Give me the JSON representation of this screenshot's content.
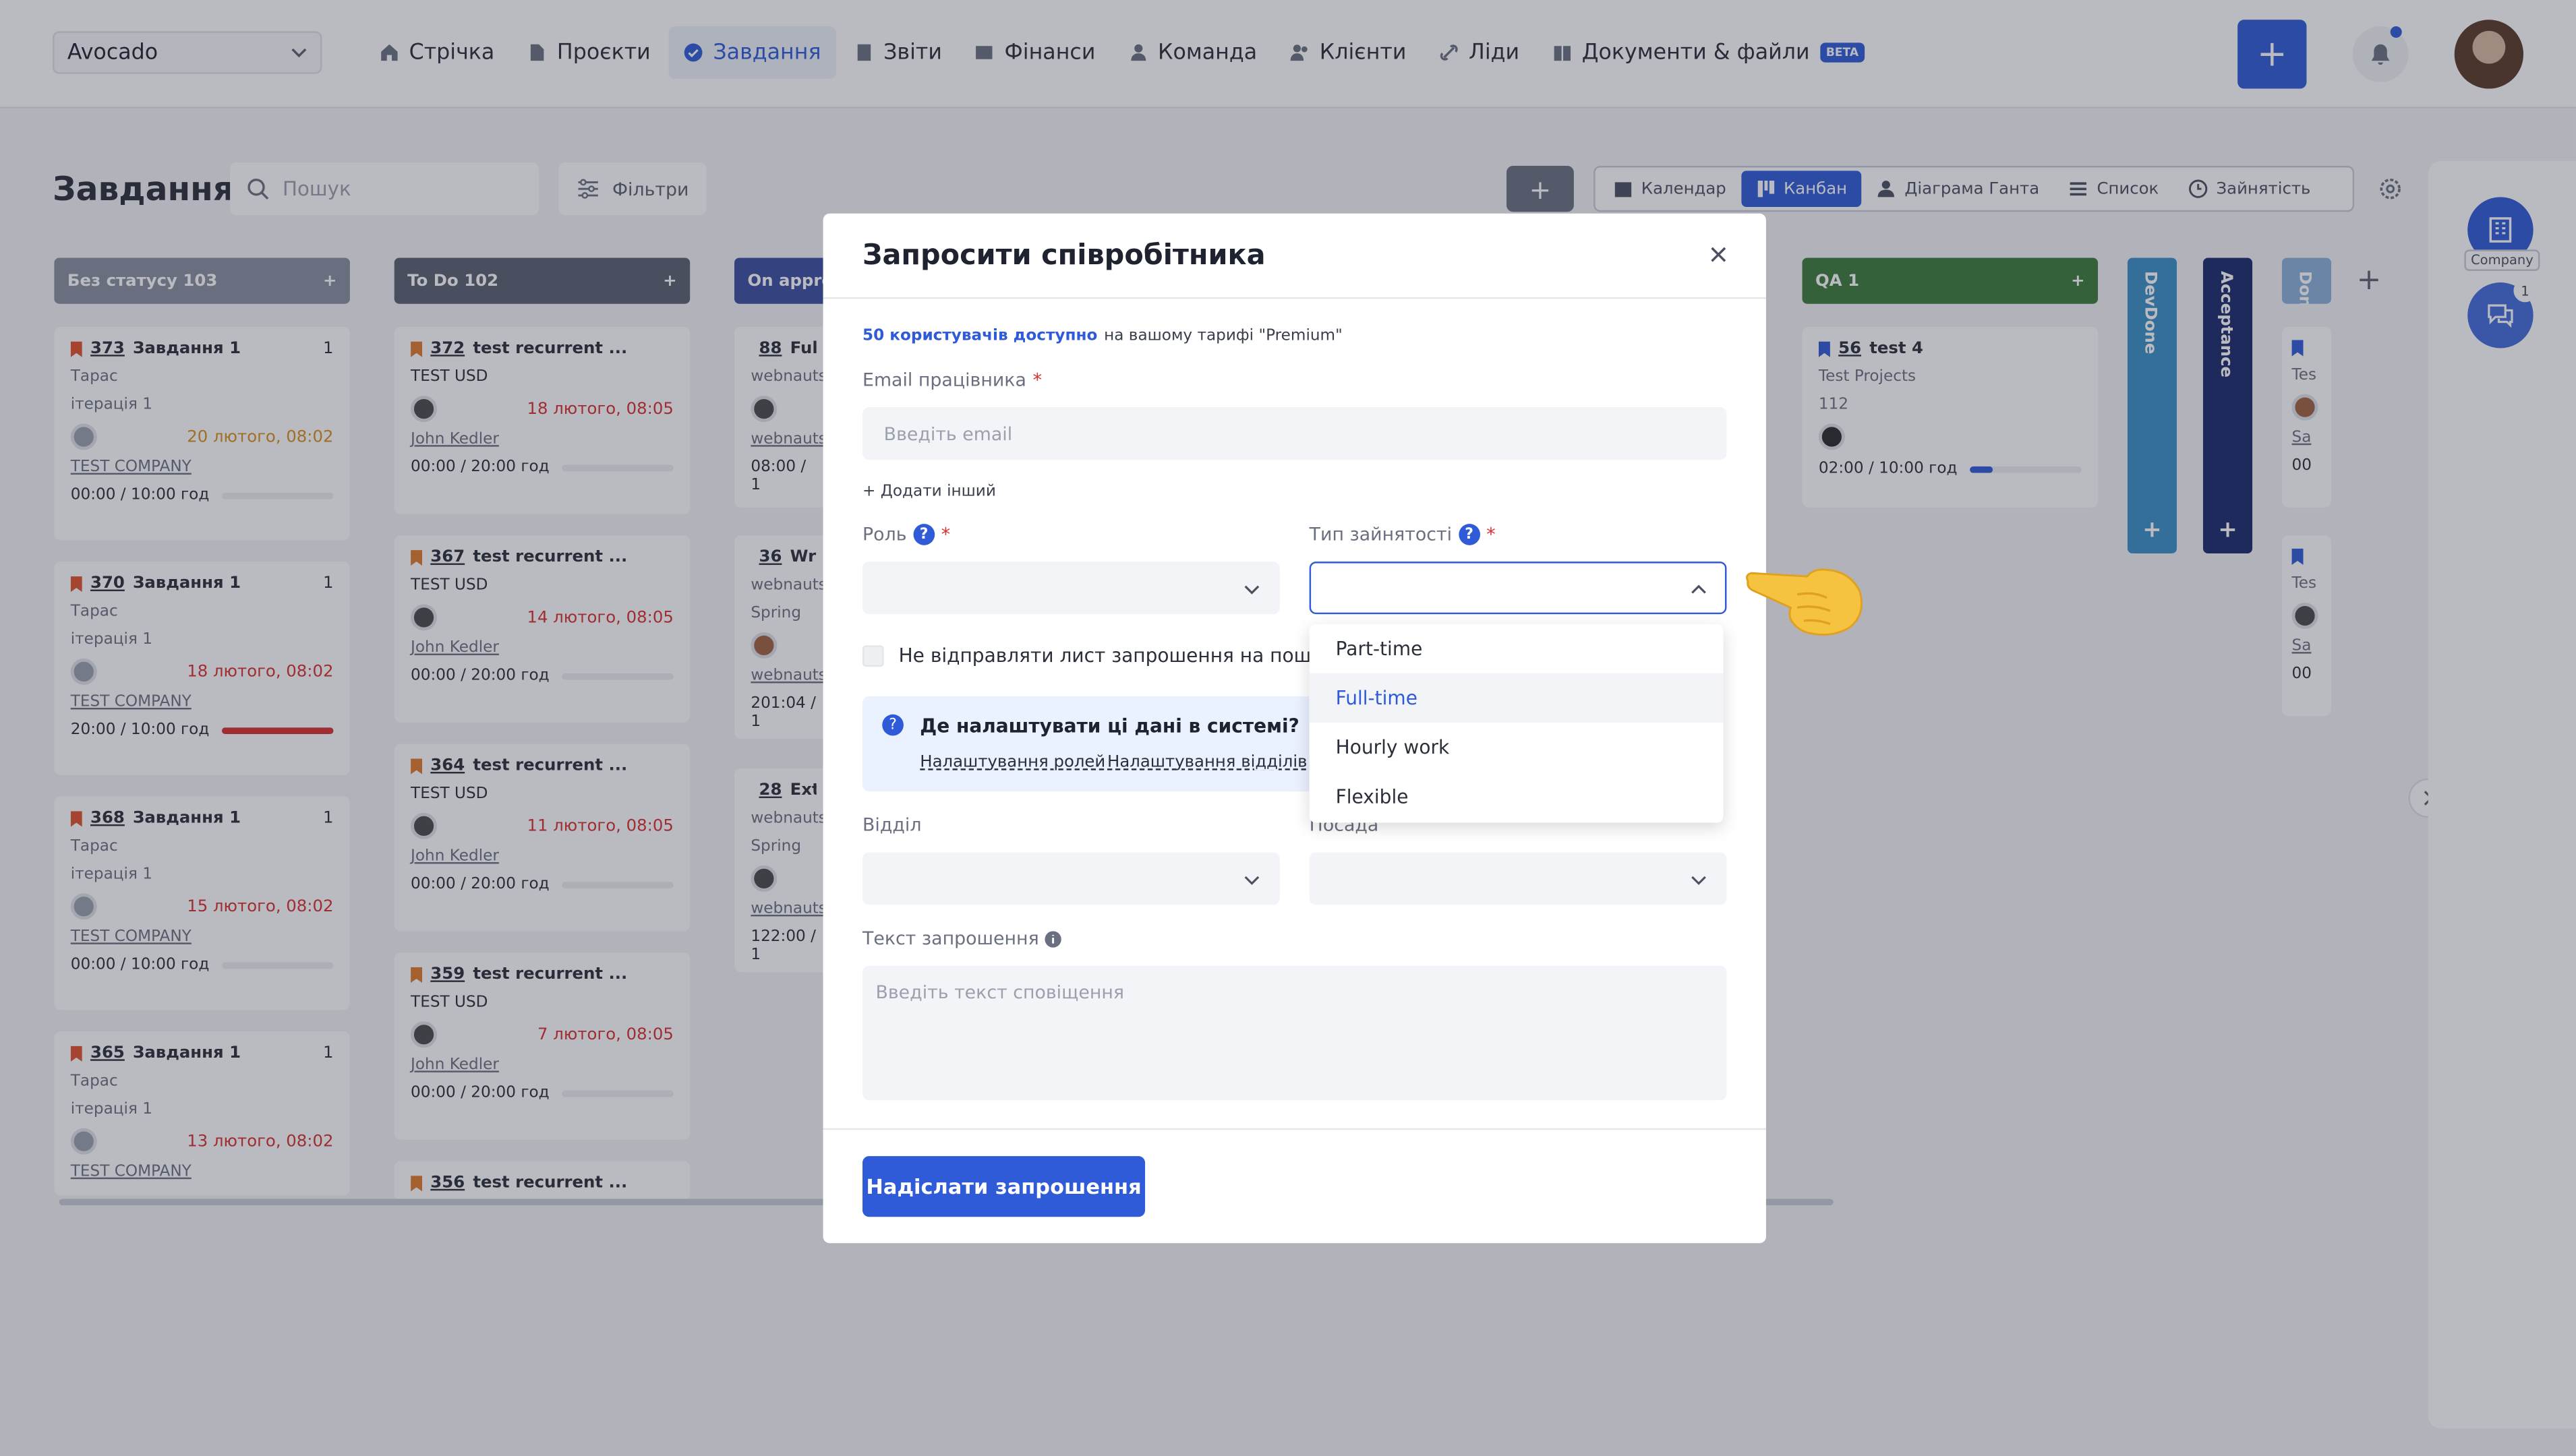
{
  "topbar": {
    "workspace": "Avocado",
    "nav": [
      {
        "label": "Стрічка",
        "icon": "home-icon"
      },
      {
        "label": "Проєкти",
        "icon": "document-icon"
      },
      {
        "label": "Завдання",
        "icon": "check-icon",
        "active": true
      },
      {
        "label": "Звіти",
        "icon": "report-icon"
      },
      {
        "label": "Фінанси",
        "icon": "wallet-icon"
      },
      {
        "label": "Команда",
        "icon": "person-icon"
      },
      {
        "label": "Клієнти",
        "icon": "people-icon"
      },
      {
        "label": "Ліди",
        "icon": "link-icon"
      },
      {
        "label": "Документи & файли",
        "icon": "book-icon",
        "badge": "BETA"
      }
    ],
    "add_label": "+"
  },
  "page": {
    "title": "Завдання",
    "search_placeholder": "Пошук",
    "filters_label": "Фільтри",
    "add_label": "+",
    "views": [
      {
        "label": "Календар",
        "icon": "calendar-icon"
      },
      {
        "label": "Канбан",
        "icon": "kanban-icon",
        "active": true
      },
      {
        "label": "Діаграма Ганта",
        "icon": "gantt-icon"
      },
      {
        "label": "Список",
        "icon": "list-icon"
      },
      {
        "label": "Зайнятість",
        "icon": "clock-icon"
      }
    ]
  },
  "board": {
    "columns": [
      {
        "title": "Без статусу 103",
        "color": "#8a90a0"
      },
      {
        "title": "To Do 102",
        "color": "#5a6070"
      },
      {
        "title": "On approv",
        "color": "#3a4fa0"
      },
      {
        "title": "QA 1",
        "color": "#3a7a3a"
      }
    ],
    "col1_cards": [
      {
        "num": "373",
        "title": "Завдання 1",
        "sub": "1",
        "user": "Тарас",
        "iter": "ітерація 1",
        "date": "20 лютого, 08:02",
        "company": "TEST COMPANY",
        "time": "00:00 / 10:00 год",
        "progress": 0
      },
      {
        "num": "370",
        "title": "Завдання 1",
        "sub": "1",
        "user": "Тарас",
        "iter": "ітерація 1",
        "date": "18 лютого, 08:02",
        "company": "TEST COMPANY",
        "time": "20:00 / 10:00 год",
        "progress": 100
      },
      {
        "num": "368",
        "title": "Завдання 1",
        "sub": "1",
        "user": "Тарас",
        "iter": "ітерація 1",
        "date": "15 лютого, 08:02",
        "company": "TEST COMPANY",
        "time": "00:00 / 10:00 год",
        "progress": 0
      },
      {
        "num": "365",
        "title": "Завдання 1",
        "sub": "1",
        "user": "Тарас",
        "iter": "ітерація 1",
        "date": "13 лютого, 08:02",
        "company": "TEST COMPANY",
        "time": "",
        "progress": 0
      }
    ],
    "col2_cards": [
      {
        "num": "372",
        "title": "test recurrent ...",
        "proj": "TEST USD",
        "date": "18 лютого, 08:05",
        "user": "John Kedler",
        "time": "00:00 / 20:00 год"
      },
      {
        "num": "367",
        "title": "test recurrent ...",
        "proj": "TEST USD",
        "date": "14 лютого, 08:05",
        "user": "John Kedler",
        "time": "00:00 / 20:00 год"
      },
      {
        "num": "364",
        "title": "test recurrent ...",
        "proj": "TEST USD",
        "date": "11 лютого, 08:05",
        "user": "John Kedler",
        "time": "00:00 / 20:00 год"
      },
      {
        "num": "359",
        "title": "test recurrent ...",
        "proj": "TEST USD",
        "date": "7 лютого, 08:05",
        "user": "John Kedler",
        "time": "00:00 / 20:00 год"
      },
      {
        "num": "356",
        "title": "test recurrent ..."
      }
    ],
    "col3_cards": [
      {
        "num": "88",
        "title": "Ful",
        "proj": "webnauts",
        "user": "webnauts",
        "time": "08:00 / 1"
      },
      {
        "num": "36",
        "title": "Wri",
        "proj": "webnauts",
        "iter": "Spring",
        "user": "webnauts",
        "time": "201:04 / 1"
      },
      {
        "num": "28",
        "title": "Ext",
        "proj": "webnauts",
        "iter": "Spring",
        "user": "webnauts",
        "time": "122:00 / 1"
      }
    ],
    "qa_card": {
      "num": "56",
      "title": "test 4",
      "proj": "Test Projects",
      "extra": "112",
      "time": "02:00 / 10:00 год",
      "progress": 20
    },
    "vertical_columns": [
      {
        "title": "DevDone",
        "color": "#3a8fc8"
      },
      {
        "title": "Acceptance",
        "color": "#1a2a6a"
      },
      {
        "title": "Don",
        "color": "#8ab0d8"
      }
    ],
    "right_col_texts": [
      "Tes",
      "Sa",
      "00"
    ]
  },
  "rail": {
    "company_label": "Company",
    "chat_badge": "1"
  },
  "modal": {
    "title": "Запросити співробітника",
    "quota_link": "50 користувачів доступно",
    "quota_text": "на вашому тарифі \"Premium\"",
    "email_label": "Email працівника",
    "email_placeholder": "Введіть email",
    "add_other": "+ Додати інший",
    "role_label": "Роль",
    "employment_label": "Тип зайнятості",
    "no_email_label": "Не відправляти лист запрошення на пошту",
    "info_title": "Де налаштувати ці дані в системі?",
    "info_link1": "Налаштування ролей",
    "info_link2": "Налаштування відділів",
    "department_label": "Відділ",
    "position_label": "Посада",
    "text_label": "Текст запрошення",
    "text_placeholder": "Введіть текст сповіщення",
    "send_label": "Надіслати запрошення",
    "employment_options": [
      "Part-time",
      "Full-time",
      "Hourly work",
      "Flexible"
    ],
    "employment_highlighted": "Full-time",
    "required_mark": "*",
    "help_mark": "?"
  },
  "colors": {
    "accent": "#2f5ad8",
    "danger": "#d83030"
  }
}
